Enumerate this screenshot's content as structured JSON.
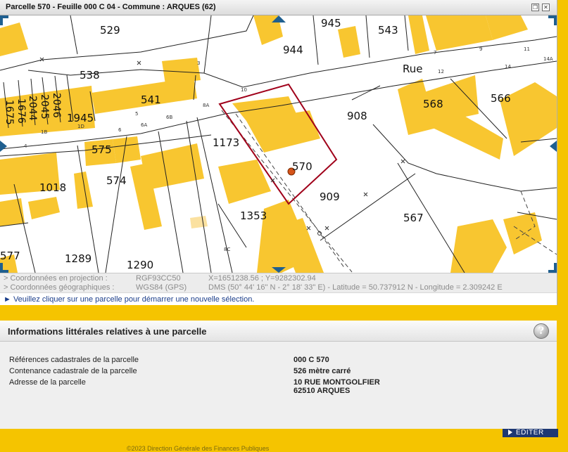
{
  "window": {
    "title": "Parcelle 570 - Feuille 000 C 04 - Commune : ARQUES (62)"
  },
  "map": {
    "street_label": "Rue",
    "parcels": [
      {
        "num": "529"
      },
      {
        "num": "945"
      },
      {
        "num": "543"
      },
      {
        "num": "944"
      },
      {
        "num": "538"
      },
      {
        "num": "541"
      },
      {
        "num": "1945"
      },
      {
        "num": "908"
      },
      {
        "num": "568"
      },
      {
        "num": "566"
      },
      {
        "num": "575"
      },
      {
        "num": "1173"
      },
      {
        "num": "570"
      },
      {
        "num": "1018"
      },
      {
        "num": "574"
      },
      {
        "num": "909"
      },
      {
        "num": "1353"
      },
      {
        "num": "567"
      },
      {
        "num": "577"
      },
      {
        "num": "1289"
      },
      {
        "num": "1290"
      }
    ],
    "vertical_parcels": [
      "2046",
      "2045",
      "2044",
      "1676",
      "1675"
    ],
    "house_numbers": [
      "10",
      "3",
      "5",
      "6",
      "6A",
      "6B",
      "8A",
      "1B",
      "1D",
      "4",
      "7",
      "9",
      "11",
      "12",
      "14",
      "14A",
      "8C"
    ],
    "marker_color": "#d6541a",
    "selected_outline_color": "#a0001a",
    "building_color": "#f8c630"
  },
  "coords": {
    "projection_label": "> Coordonnées en projection :",
    "projection_system": "RGF93CC50",
    "projection_value": "X=1651238.56 ; Y=9282302.94",
    "geo_label": "> Coordonnées géographiques :",
    "geo_system": "WGS84 (GPS)",
    "geo_value": "DMS (50° 44' 16\" N - 2° 18' 33\" E) - Latitude = 50.737912 N - Longitude = 2.309242 E"
  },
  "hint": "► Veuillez cliquer sur une parcelle pour démarrer une nouvelle sélection.",
  "info": {
    "title": "Informations littérales relatives à une parcelle",
    "help_glyph": "?",
    "rows": [
      {
        "label": "Références cadastrales de la parcelle",
        "value": "000 C 570"
      },
      {
        "label": "Contenance cadastrale de la parcelle",
        "value": "526 mètre carré"
      },
      {
        "label": "Adresse de la parcelle",
        "value": "10 RUE MONTGOLFIER",
        "value2": "62510 ARQUES"
      }
    ],
    "edit_label": "ÉDITER"
  },
  "footer": "©2023 Direction Générale des Finances Publiques"
}
